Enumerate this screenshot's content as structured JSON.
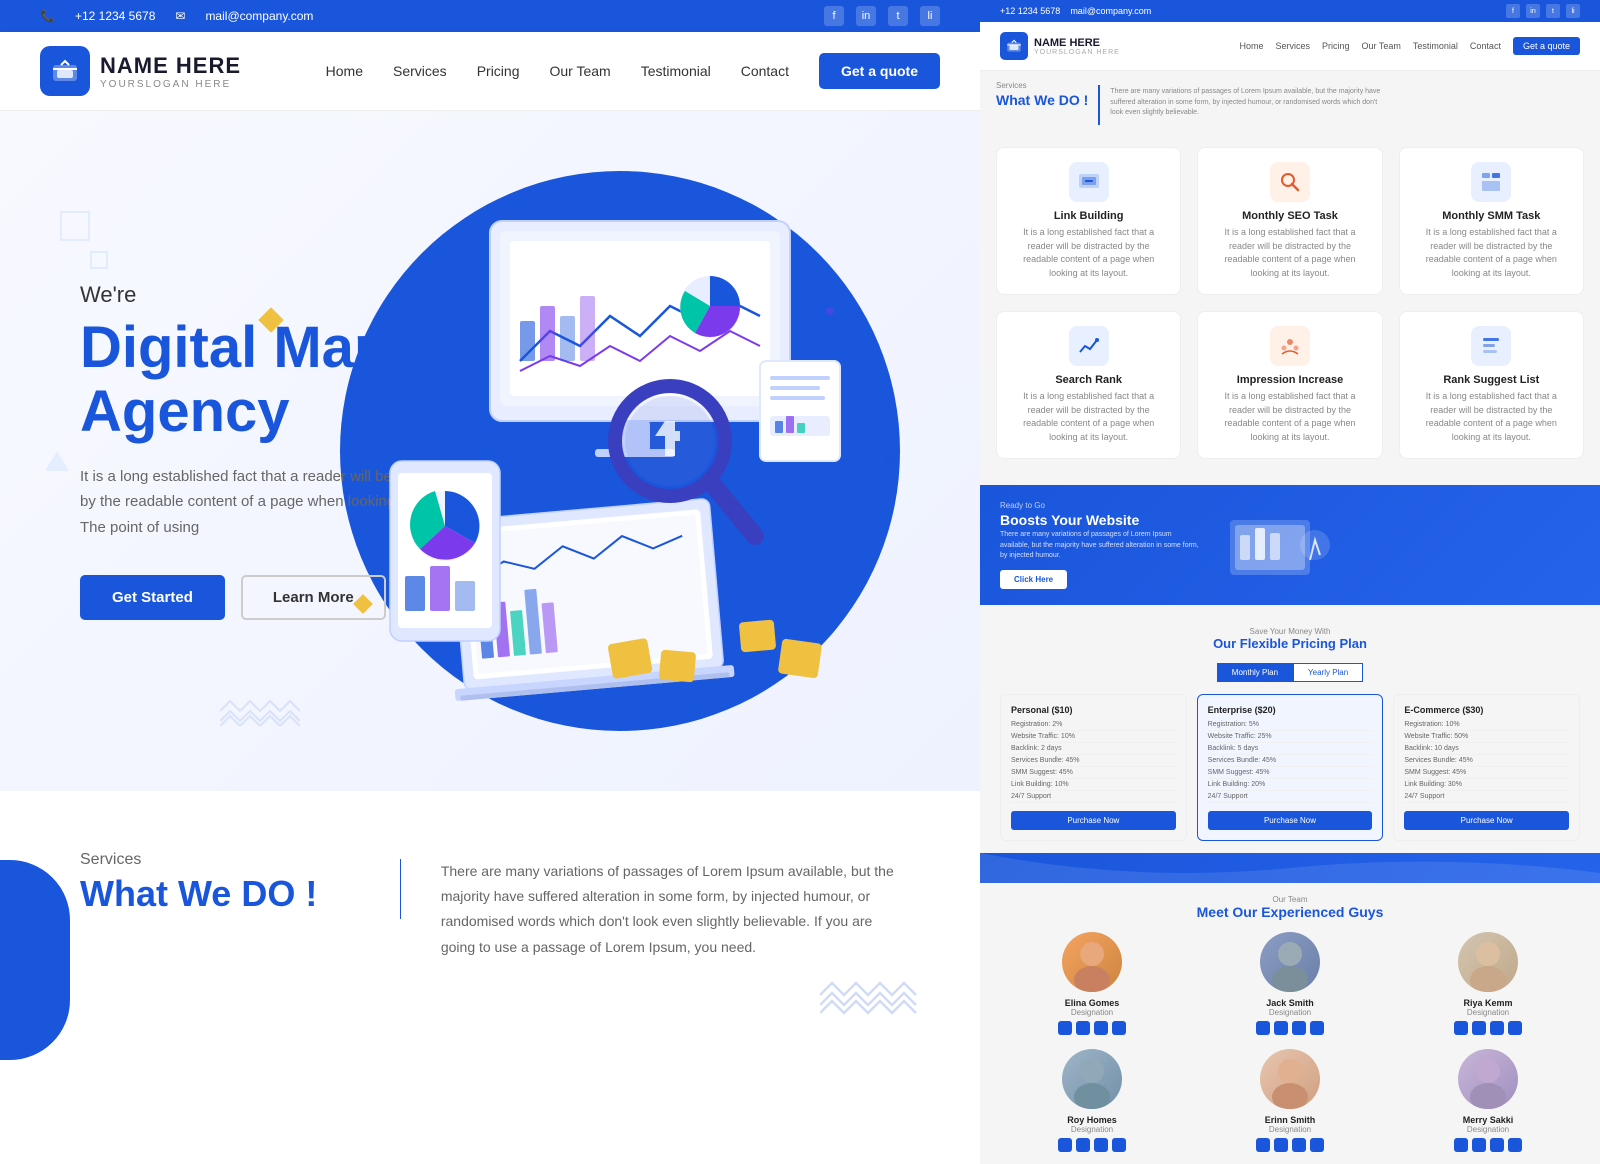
{
  "topbar": {
    "phone": "+12 1234 5678",
    "email": "mail@company.com",
    "socials": [
      "f",
      "in",
      "t",
      "li"
    ]
  },
  "header": {
    "logo_name": "NAME HERE",
    "logo_slogan": "YOURSLOGAN HERE",
    "nav_items": [
      "Home",
      "Services",
      "Pricing",
      "Our Team",
      "Testimonial",
      "Contact"
    ],
    "cta_label": "Get a quote"
  },
  "hero": {
    "pre_title": "We're",
    "title_line1": "Digital Marketing",
    "title_line2": "Agency",
    "description": "It is a long established fact that a reader will be distracted by the readable content of a page when looking at its layout. The point of using",
    "btn_started": "Get Started",
    "btn_learn": "Learn More"
  },
  "services_section": {
    "label": "Services",
    "title": "What We DO !",
    "description": "There are many variations of passages of Lorem Ipsum available, but the majority have suffered alteration in some form, by injected humour, or randomised words which don't look even slightly believable. If you are going to use a passage of Lorem Ipsum, you need."
  },
  "right_panel": {
    "topbar_phone": "+12 1234 5678",
    "topbar_email": "mail@company.com",
    "logo": "NAME HERE",
    "nav": [
      "Home",
      "Services",
      "Pricing",
      "Our Team",
      "Testimonial",
      "Contact"
    ],
    "cta": "Get a quote",
    "services_label": "Services",
    "services_title": "What We DO !",
    "services_desc": "There are many variations of passages of Lorem Ipsum available, but the majority have suffered alteration in some form, by injected humour, or randomised words which don't look even slightly believable.",
    "service_cards": [
      {
        "title": "Link Building",
        "color": "#1a56db"
      },
      {
        "title": "Monthly SEO Task",
        "color": "#e55a2b"
      },
      {
        "title": "Monthly SMM Task",
        "color": "#1a56db"
      },
      {
        "title": "Search Rank",
        "color": "#1a56db"
      },
      {
        "title": "Impression Increase",
        "color": "#e55a2b"
      },
      {
        "title": "Rank Suggest List",
        "color": "#1a56db"
      }
    ],
    "boost_label": "Ready to Go",
    "boost_title": "Boosts Your Website",
    "boost_desc": "There are many variations of passages of Lorem Ipsum available, but the majority have suffered alteration in some form, by injected humour.",
    "boost_btn": "Click Here",
    "pricing_label": "Save Your Money With",
    "pricing_title": "Our Flexible Pricing Plan",
    "pricing_tab1": "Monthly Plan",
    "pricing_tab2": "Yearly Plan",
    "price_cards": [
      {
        "title": "Personal ($10)",
        "features": [
          "Registration: 2%",
          "Website Traffic: 10%",
          "Backlink: 2 days",
          "Services Bundle: 45%",
          "SMM Suggest: 45%",
          "Link Building: 10%",
          "24/7 Support"
        ]
      },
      {
        "title": "Enterprise ($20)",
        "features": [
          "Registration: 5%",
          "Website Traffic: 25%",
          "Backlink: 5 days",
          "Services Bundle: 45%",
          "SMM Suggest: 45%",
          "Link Building: 20%",
          "24/7 Support"
        ]
      },
      {
        "title": "E-Commerce ($30)",
        "features": [
          "Registration: 10%",
          "Website Traffic: 50%",
          "Backlink: 10 days",
          "Services Bundle: 45%",
          "SMM Suggest: 45%",
          "Link Building: 30%",
          "24/7 Support"
        ]
      }
    ],
    "price_btn": "Purchase Now",
    "team_label": "Our Team",
    "team_title": "Meet Our Experienced Guys",
    "team_members": [
      {
        "name": "Elina Gomes",
        "role": "Designation"
      },
      {
        "name": "Jack Smith",
        "role": "Designation"
      },
      {
        "name": "Riya Kemm",
        "role": "Designation"
      },
      {
        "name": "Roy Homes",
        "role": "Designation"
      },
      {
        "name": "Erinn Smith",
        "role": "Designation"
      },
      {
        "name": "Merry Sakki",
        "role": "Designation"
      }
    ]
  }
}
